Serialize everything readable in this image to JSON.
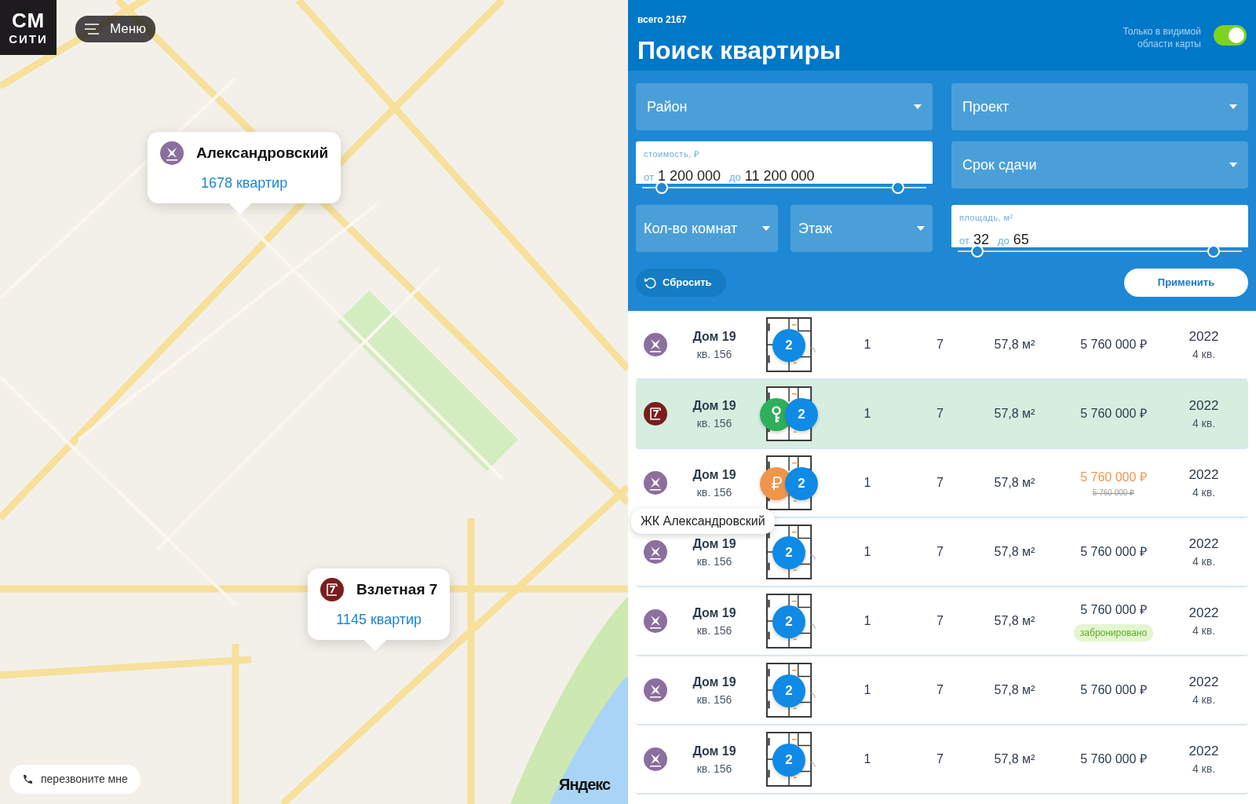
{
  "map": {
    "logo": {
      "line_1": "СМ",
      "line_2": "СИТИ"
    },
    "menu": {
      "label": "Меню"
    },
    "popups": [
      {
        "kind": "flower",
        "name": "Александровский",
        "count": "1678 квартир"
      },
      {
        "kind": "frame",
        "name": "Взлетная 7",
        "count": "1145 квартир"
      }
    ],
    "callback": {
      "label": "перезвоните мне"
    },
    "provider_logo": "Яндекс"
  },
  "panel": {
    "total": "всего 2167",
    "title": "Поиск квартиры",
    "visible_only": {
      "label": "Только в видимой области карты",
      "on": true
    },
    "filters": {
      "district": {
        "label": "Район"
      },
      "project": {
        "label": "Проект"
      },
      "price": {
        "label": "стоимость, ₽",
        "from_word": "от",
        "from": "1 200 000",
        "to_word": "до",
        "to": "11 200 000",
        "thumbs": [
          {
            "level": 0.07
          },
          {
            "level": 0.9
          }
        ]
      },
      "deadline": {
        "label": "Срок сдачи"
      },
      "rooms": {
        "label": "Кол-во комнат"
      },
      "floor": {
        "label": "Этаж"
      },
      "area": {
        "label": "площадь, м²",
        "from_word": "от",
        "from": "32",
        "to_word": "до",
        "to": "65",
        "thumbs": [
          {
            "level": 0.07
          },
          {
            "level": 0.9
          }
        ]
      }
    },
    "reset": {
      "label": "Сбросить"
    },
    "apply": {
      "label": "Применить"
    }
  },
  "rows": [
    {
      "kind": "flower",
      "house": "Дом 19",
      "apartment": "кв. 156",
      "plan_badge": "2",
      "rooms": "1",
      "floor": "7",
      "area": "57,8 м²",
      "price": "5 760 000 ₽",
      "discount": false,
      "year": "2022",
      "quarter": "4 кв.",
      "selected": false
    },
    {
      "kind": "frame",
      "house": "Дом 19",
      "apartment": "кв. 156",
      "plan_badge": "2",
      "extra_badge": {
        "kind": "key"
      },
      "rooms": "1",
      "floor": "7",
      "area": "57,8 м²",
      "price": "5 760 000 ₽",
      "discount": false,
      "year": "2022",
      "quarter": "4 кв.",
      "selected": true
    },
    {
      "kind": "flower",
      "house": "Дом 19",
      "apartment": "кв. 156",
      "plan_badge": "2",
      "extra_badge": {
        "kind": "ruble"
      },
      "rooms": "1",
      "floor": "7",
      "area": "57,8 м²",
      "price": "5 760 000 ₽",
      "discount": true,
      "old_price": "5 760 000 ₽",
      "year": "2022",
      "quarter": "4 кв.",
      "selected": false
    },
    {
      "kind": "flower",
      "house": "Дом 19",
      "apartment": "кв. 156",
      "plan_badge": "2",
      "rooms": "1",
      "floor": "7",
      "area": "57,8 м²",
      "price": "5 760 000 ₽",
      "discount": false,
      "year": "2022",
      "quarter": "4 кв.",
      "selected": false,
      "tooltip": "ЖК Александровский"
    },
    {
      "kind": "flower",
      "house": "Дом 19",
      "apartment": "кв. 156",
      "plan_badge": "2",
      "rooms": "1",
      "floor": "7",
      "area": "57,8 м²",
      "price": "5 760 000 ₽",
      "discount": false,
      "status": "забронировано",
      "year": "2022",
      "quarter": "4 кв.",
      "selected": false
    },
    {
      "kind": "flower",
      "house": "Дом 19",
      "apartment": "кв. 156",
      "plan_badge": "2",
      "rooms": "1",
      "floor": "7",
      "area": "57,8 м²",
      "price": "5 760 000 ₽",
      "discount": false,
      "year": "2022",
      "quarter": "4 кв.",
      "selected": false
    },
    {
      "kind": "flower",
      "house": "Дом 19",
      "apartment": "кв. 156",
      "plan_badge": "2",
      "rooms": "1",
      "floor": "7",
      "area": "57,8 м²",
      "price": "5 760 000 ₽",
      "discount": false,
      "year": "2022",
      "quarter": "4 кв.",
      "selected": false
    }
  ]
}
